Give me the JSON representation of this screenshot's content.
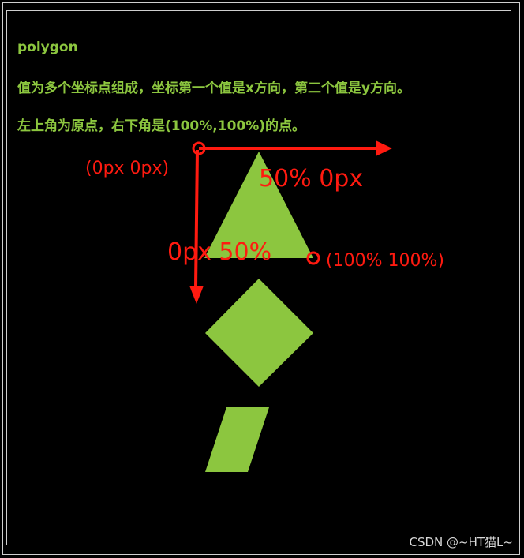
{
  "header": {
    "title": "polygon",
    "line1": "值为多个坐标点组成，坐标第一个值是x方向，第二个值是y方向。",
    "line2": "左上角为原点，右下角是(100%,100%)的点。"
  },
  "annotations": {
    "origin": "(0px 0px)",
    "top_point": "50% 0px",
    "left_point": "0px 50%",
    "bottom_right": "(100% 100%)"
  },
  "colors": {
    "shape_fill": "#8cc63f",
    "annotation_red": "#ff1a10",
    "background": "#000000",
    "frame": "#cfcfcf"
  },
  "shapes": [
    "triangle",
    "diamond",
    "parallelogram"
  ],
  "watermark": "CSDN @~HT猫L~"
}
